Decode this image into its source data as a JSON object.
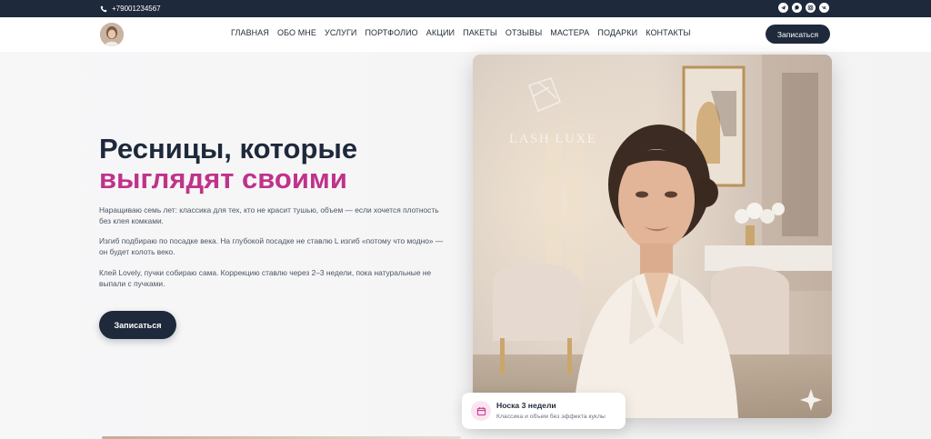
{
  "topbar": {
    "phone": "+79001234567",
    "social_icons": [
      "telegram-icon",
      "chat-icon",
      "instagram-icon",
      "vk-icon"
    ]
  },
  "nav": {
    "items": [
      "ГЛАВНАЯ",
      "ОБО МНЕ",
      "УСЛУГИ",
      "ПОРТФОЛИО",
      "АКЦИИ",
      "ПАКЕТЫ",
      "ОТЗЫВЫ",
      "МАСТЕРА",
      "ПОДАРКИ",
      "КОНТАКТЫ"
    ],
    "cta_label": "Записаться"
  },
  "hero": {
    "title_line1": "Ресницы, которые",
    "title_line2": "выглядят своими",
    "paragraphs": [
      "Наращиваю семь лет: классика для тех, кто не красит тушью, объем — если хочется плотность без клея комками.",
      "Изгиб подбираю по посадке века. На глубокой посадке не ставлю L изгиб «потому что модно» — он будет колоть веко.",
      "Клей Lovely, пучки собираю сама. Коррекцию ставлю через 2–3 недели, пока натуральные не выпали с пучками."
    ],
    "cta_label": "Записаться"
  },
  "photo": {
    "wall_sign": "LASH LUXE"
  },
  "badge": {
    "title": "Носка 3 недели",
    "subtitle": "Классика и объем без эффекта куклы"
  },
  "colors": {
    "navy": "#1e293b",
    "accent": "#c0338a",
    "badge_icon_bg": "#fbe4f0"
  }
}
